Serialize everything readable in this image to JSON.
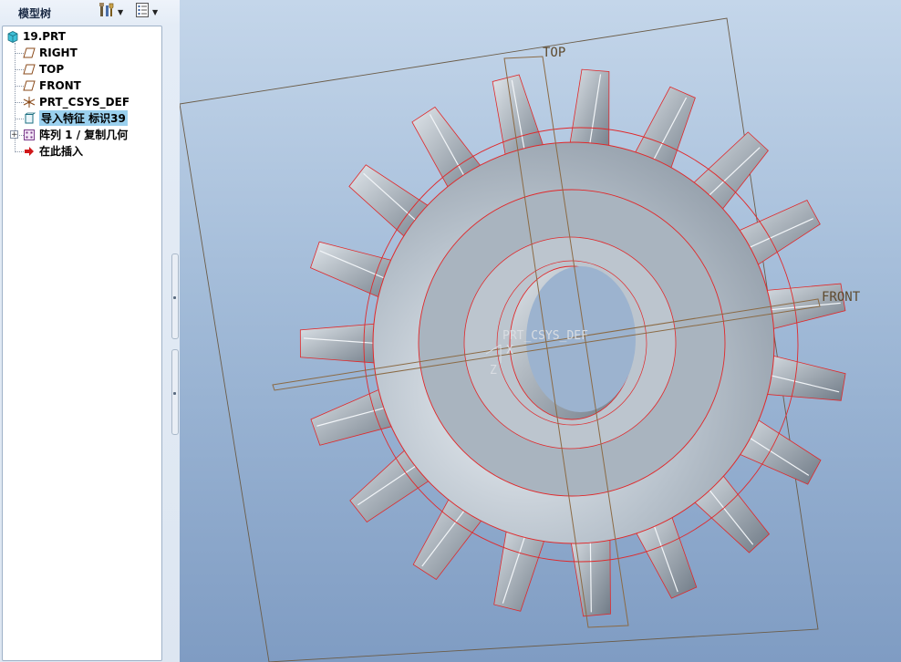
{
  "panel": {
    "title": "模型树",
    "toolbar": {
      "settings_icon": "tools-icon",
      "show_icon": "list-icon"
    }
  },
  "tree": {
    "items": [
      {
        "label": "19.PRT",
        "icon": "part-icon"
      },
      {
        "label": "RIGHT",
        "icon": "datum-plane-icon"
      },
      {
        "label": "TOP",
        "icon": "datum-plane-icon"
      },
      {
        "label": "FRONT",
        "icon": "datum-plane-icon"
      },
      {
        "label": "PRT_CSYS_DEF",
        "icon": "csys-icon"
      },
      {
        "label": "导入特征 标识39",
        "icon": "import-feature-icon",
        "selected": true
      },
      {
        "label": "阵列 1 / 复制几何",
        "icon": "pattern-icon",
        "expandable": true
      },
      {
        "label": "在此插入",
        "icon": "insert-here-arrow-icon"
      }
    ]
  },
  "viewport": {
    "datum_top_label": "TOP",
    "datum_front_label": "FRONT",
    "csys_label": "PRT_CSYS_DEF",
    "csys_axis_x": "X",
    "csys_axis_z": "Z",
    "colors": {
      "edge_highlight": "#e0282a",
      "datum_plane": "#8b6a44",
      "gear_body": "#9aa5b1"
    }
  }
}
